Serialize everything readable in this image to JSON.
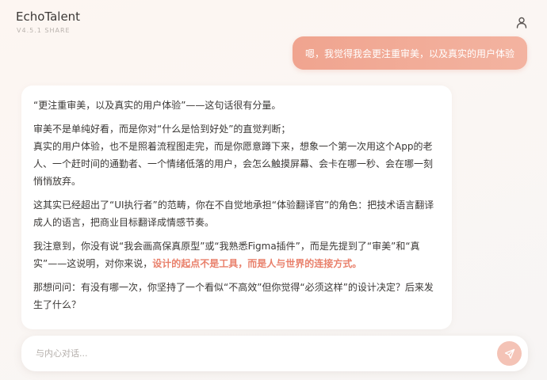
{
  "app": {
    "title": "EchoTalent",
    "version": "V4.5.1 SHARE"
  },
  "icons": {
    "user": "user-icon",
    "send": "send-icon"
  },
  "colors": {
    "accent": "#f0a48f",
    "highlight": "#e9806b",
    "send_button": "#f4c3b6"
  },
  "conversation": {
    "user_message": "嗯，我觉得我会更注重审美，以及真实的用户体验",
    "ai_reply": {
      "p1": "“更注重审美，以及真实的用户体验”——这句话很有分量。",
      "p2_line1": "审美不是单纯好看，而是你对“什么是恰到好处”的直觉判断；",
      "p2_line2": "真实的用户体验，也不是照着流程图走完，而是你愿意蹲下来，想象一个第一次用这个App的老人、一个赶时间的通勤者、一个情绪低落的用户，会怎么触摸屏幕、会卡在哪一秒、会在哪一刻悄悄放弃。",
      "p3": "这其实已经超出了“UI执行者”的范畴，你在不自觉地承担“体验翻译官”的角色：把技术语言翻译成人的语言，把商业目标翻译成情感节奏。",
      "p4_prefix": "我注意到，你没有说“我会画高保真原型”或“我熟悉Figma插件”，而是先提到了“审美”和“真实”——这说明，对你来说，",
      "p4_highlight": "设计的起点不是工具，而是人与世界的连接方式。",
      "p5": "那想问问：有没有哪一次，你坚持了一个看似“不高效”但你觉得“必须这样”的设计决定？后来发生了什么？"
    }
  },
  "composer": {
    "placeholder": "与内心对话..."
  }
}
